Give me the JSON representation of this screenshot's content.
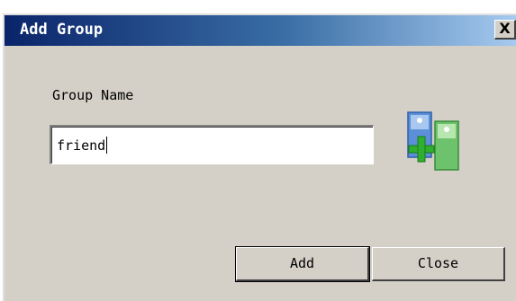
{
  "window": {
    "title": "Add Group",
    "close_glyph": "X"
  },
  "form": {
    "group_name_label": "Group Name",
    "group_name_value": "friend"
  },
  "icon": {
    "name": "add-group-icon",
    "colors": {
      "left_card": "#5b8fd8",
      "right_card": "#6cc36c",
      "plus": "#2fae2f"
    }
  },
  "buttons": {
    "add_label": "Add",
    "close_label": "Close"
  },
  "colors": {
    "titlebar_start": "#0a246a",
    "titlebar_end": "#a6caf0",
    "face": "#d4d0c8"
  }
}
